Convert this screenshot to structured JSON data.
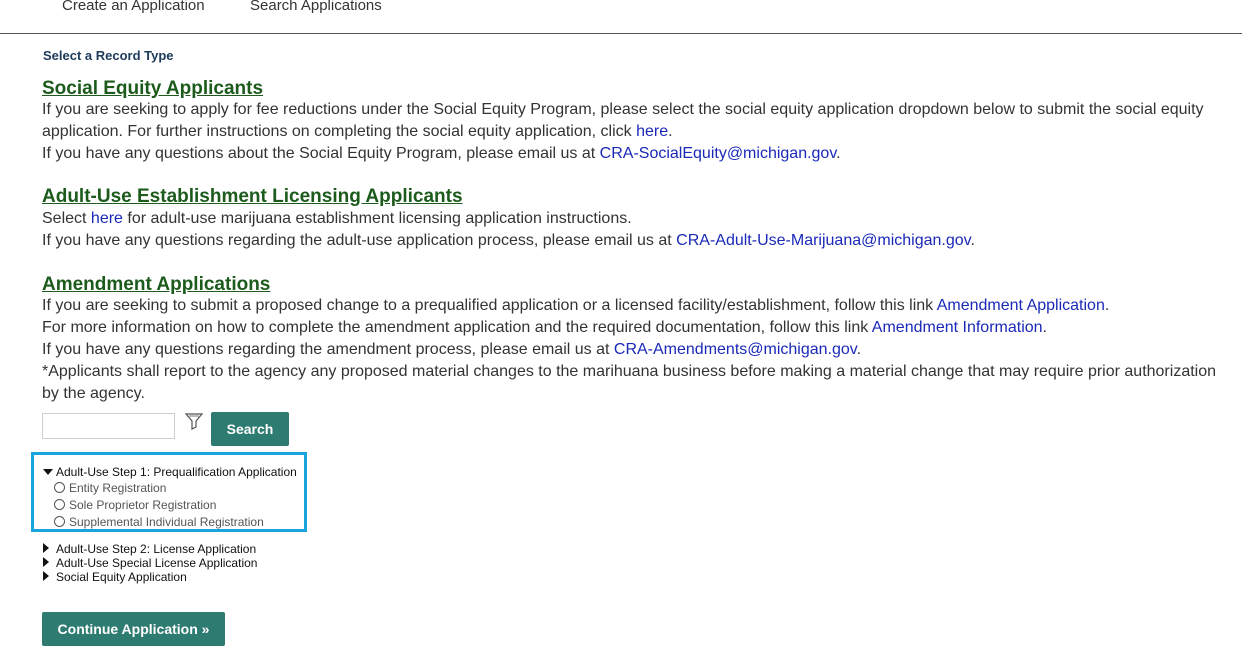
{
  "topnav": {
    "tabs": [
      "Create an Application",
      "Search Applications"
    ]
  },
  "record_type_label": "Select a Record Type",
  "social_equity": {
    "heading": "Social Equity Applicants",
    "line1": "If you are seeking to apply for fee reductions under the Social Equity Program, please select the social equity application dropdown below to submit the social equity application. For further instructions on completing the social equity application, click ",
    "link_here": "here",
    "line1_end": ".",
    "line2": "If you have any questions about the Social Equity Program, please email us at ",
    "email": "CRA-SocialEquity@michigan.gov",
    "line2_end": "."
  },
  "adult_use": {
    "heading": "Adult-Use Establishment Licensing Applicants",
    "line1_pre": "Select ",
    "link_here": "here",
    "line1_post": " for adult-use marijuana establishment licensing application instructions.",
    "line2": "If you have any questions regarding the adult-use application process, please email us at ",
    "email": "CRA-Adult-Use-Marijuana@michigan.gov",
    "line2_end": "."
  },
  "amendment": {
    "heading": "Amendment Applications",
    "line1": "If you are seeking to submit a proposed change to a prequalified application or a licensed facility/establishment, follow this link ",
    "link1": "Amendment Application",
    "line1_end": ".",
    "line2": "For more information on how to complete the amendment application and the required documentation, follow this link ",
    "link2": "Amendment Information",
    "line2_end": ".",
    "line3": "If you have any questions regarding the amendment process, please email us at ",
    "email": "CRA-Amendments@michigan.gov",
    "line3_end": ".",
    "line4": "*Applicants shall report to the agency any proposed material changes to the marihuana business before making a material change that may require prior authorization by the agency."
  },
  "search": {
    "input_value": "",
    "button_label": "Search"
  },
  "tree": {
    "expanded": {
      "label": "Adult-Use Step 1: Prequalification Application",
      "options": [
        "Entity Registration",
        "Sole Proprietor Registration",
        "Supplemental Individual Registration"
      ]
    },
    "collapsed": [
      "Adult-Use Step 2: License Application",
      "Adult-Use Special License Application",
      "Social Equity Application"
    ]
  },
  "continue_label": "Continue Application »",
  "colors": {
    "heading_green": "#1c5b1c",
    "link_blue": "#1a29b8",
    "button_teal": "#2e7b72",
    "highlight_blue": "#1aa4dc"
  },
  "icons": [
    "filter-icon",
    "caret-down-icon",
    "caret-right-icon",
    "radio-icon"
  ]
}
